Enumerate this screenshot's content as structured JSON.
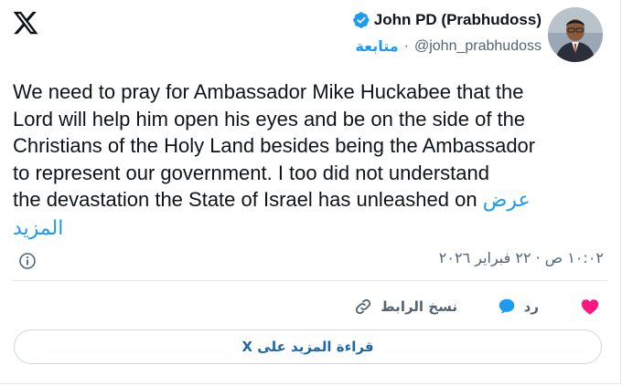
{
  "author": {
    "name": "John PD (Prabhudoss)",
    "handle": "@john_prabhudoss",
    "separator": "·",
    "follow_label": "متابعة"
  },
  "tweet": {
    "text": "We need to pray for Ambassador Mike Huckabee that the\nLord will help him open his eyes and be on the side of the\nChristians of the Holy Land besides being the Ambassador\nto represent our government.  I too did not understand\nthe devastation the State of Israel has unleashed on ",
    "show_more_line1": "عرض",
    "show_more_line2": "المزيد",
    "timestamp": "١٠:٠٢ ص · ٢٢ فبراير ٢٠٢٦"
  },
  "actions": {
    "reply_label": "رد",
    "copy_link_label": "نسخ الرابط"
  },
  "read_more_button": "قراءة المزيد على X",
  "colors": {
    "accent": "#1d9bf0",
    "like": "#f91880",
    "secondary_text": "#536471",
    "primary_text": "#0f1419"
  },
  "icons": [
    "x-logo-icon",
    "verified-badge-icon",
    "info-icon",
    "heart-icon",
    "reply-bubble-icon",
    "link-icon"
  ]
}
